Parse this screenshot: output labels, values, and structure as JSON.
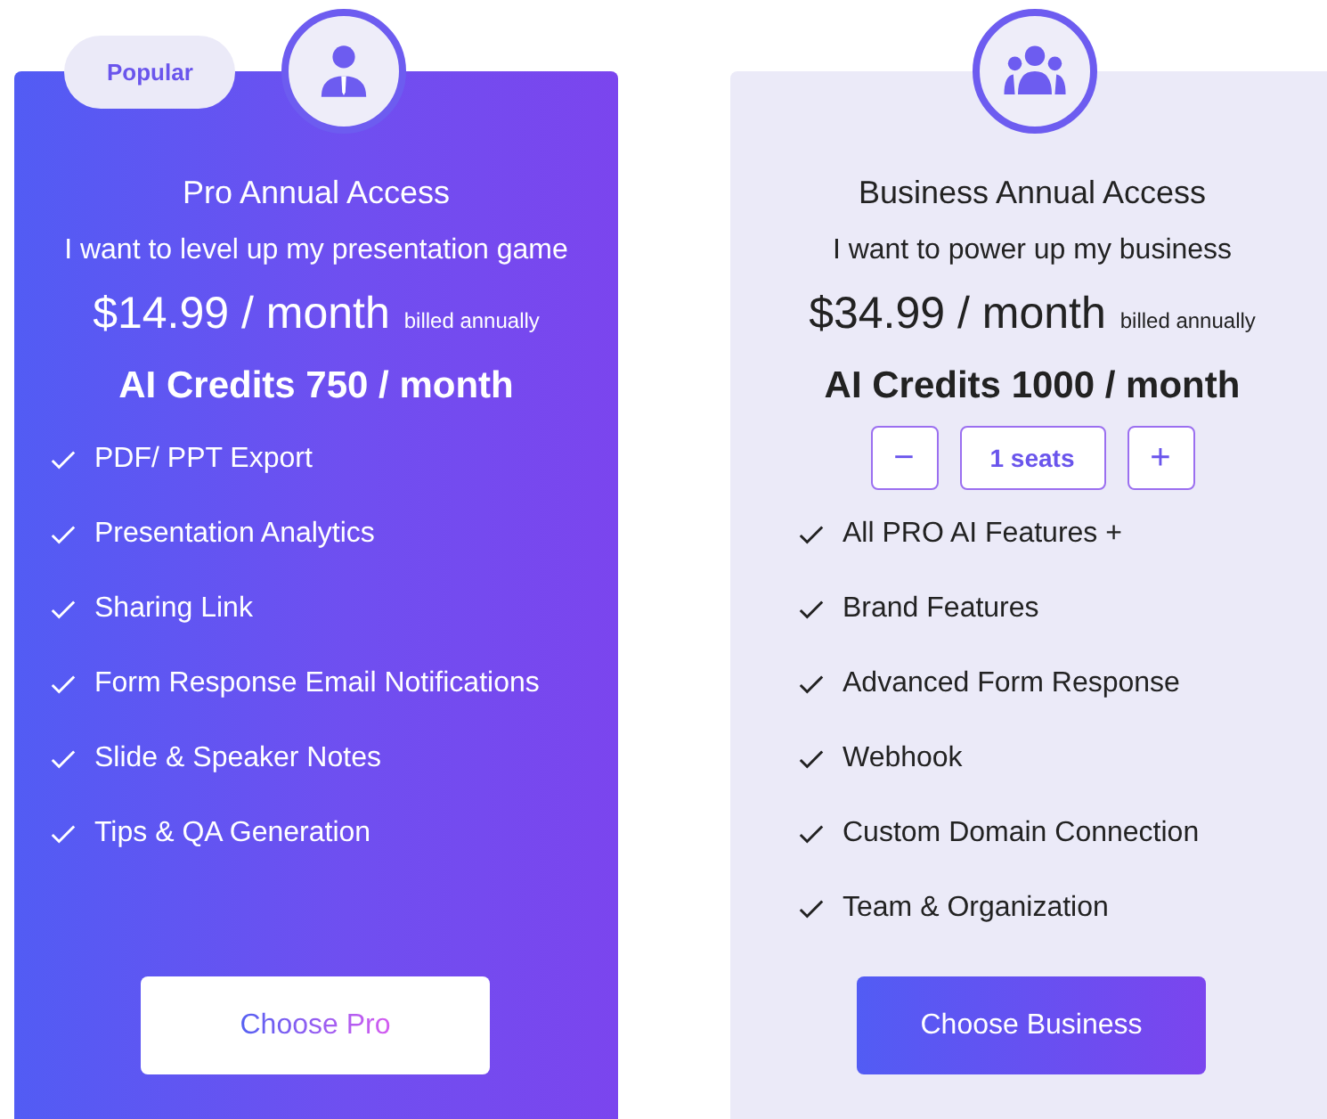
{
  "plans": [
    {
      "kind": "pro",
      "badge": "Popular",
      "title": "Pro Annual Access",
      "subtitle": "I want to level up my presentation game",
      "price": "$14.99 / month",
      "billing": "billed annually",
      "credits": "AI Credits 750 / month",
      "features": [
        "PDF/ PPT Export",
        "Presentation Analytics",
        "Sharing Link",
        "Form Response Email Notifications",
        "Slide & Speaker Notes",
        "Tips & QA Generation"
      ],
      "button": "Choose Pro"
    },
    {
      "kind": "business",
      "title": "Business Annual Access",
      "subtitle": "I want to power up my business",
      "price": "$34.99 / month",
      "billing": "billed annually",
      "credits": "AI Credits 1000 / month",
      "seats": {
        "minus": "−",
        "value": "1 seats",
        "plus": "+"
      },
      "features": [
        "All PRO AI Features +",
        "Brand Features",
        "Advanced Form Response",
        "Webhook",
        "Custom Domain Connection",
        "Team & Organization"
      ],
      "button": "Choose Business"
    }
  ]
}
